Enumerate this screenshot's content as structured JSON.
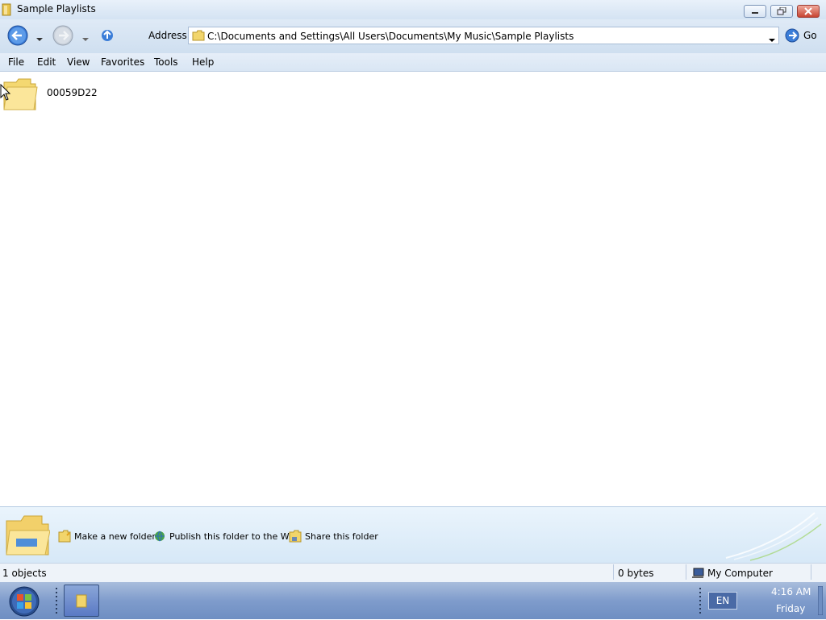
{
  "window": {
    "title": "Sample Playlists"
  },
  "toolbar": {
    "address_label": "Address",
    "address_value": "C:\\Documents and Settings\\All Users\\Documents\\My Music\\Sample Playlists",
    "go_label": "Go"
  },
  "menu": {
    "items": [
      {
        "label": "File"
      },
      {
        "label": "Edit"
      },
      {
        "label": "View"
      },
      {
        "label": "Favorites"
      },
      {
        "label": "Tools"
      },
      {
        "label": "Help"
      }
    ]
  },
  "content": {
    "items": [
      {
        "name": "00059D22",
        "icon": "folder-icon"
      }
    ]
  },
  "tasks": {
    "items": [
      {
        "label": "Make a new folder",
        "icon": "new-folder-icon"
      },
      {
        "label": "Publish this folder to the Web",
        "icon": "globe-icon"
      },
      {
        "label": "Share this folder",
        "icon": "share-folder-icon"
      }
    ]
  },
  "status": {
    "objects": "1 objects",
    "size": "0 bytes",
    "location": "My Computer"
  },
  "taskbar": {
    "language": "EN",
    "time": "4:16 AM",
    "day": "Friday"
  },
  "colors": {
    "titlebar": "#d4e3f3",
    "taskbar": "#7f9ccc",
    "close_button": "#c64432"
  }
}
